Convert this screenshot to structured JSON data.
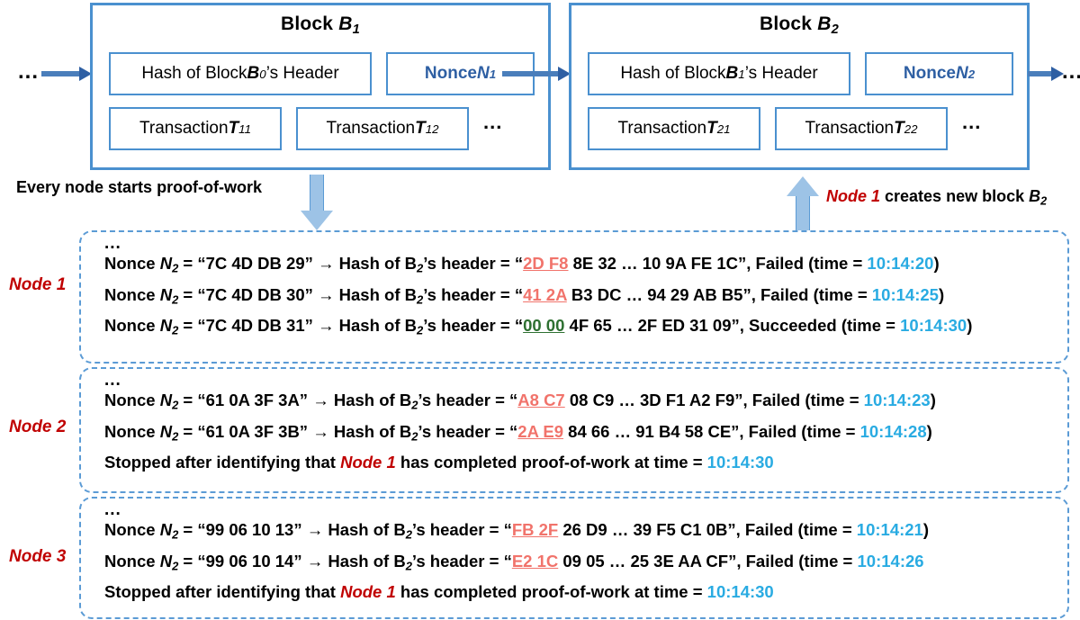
{
  "chain": {
    "left_ellipsis": "...",
    "right_ellipsis": "...",
    "blocks": [
      {
        "title_prefix": "Block ",
        "title_var": "B",
        "title_sub": "1",
        "hash_prefix": "Hash of Block ",
        "hash_var": "B",
        "hash_sub": "0",
        "hash_suffix": "’s Header",
        "nonce_prefix": "Nonce ",
        "nonce_var": "N",
        "nonce_sub": "1",
        "txn_1_prefix": "Transaction ",
        "txn_1_var": "T",
        "txn_1_sub": "11",
        "txn_2_prefix": "Transaction ",
        "txn_2_var": "T",
        "txn_2_sub": "12",
        "txn_ellipsis": "..."
      },
      {
        "title_prefix": "Block ",
        "title_var": "B",
        "title_sub": "2",
        "hash_prefix": "Hash of Block ",
        "hash_var": "B",
        "hash_sub": "1",
        "hash_suffix": "’s Header",
        "nonce_prefix": "Nonce ",
        "nonce_var": "N",
        "nonce_sub": "2",
        "txn_1_prefix": "Transaction ",
        "txn_1_var": "T",
        "txn_1_sub": "21",
        "txn_2_prefix": "Transaction ",
        "txn_2_var": "T",
        "txn_2_sub": "22",
        "txn_ellipsis": "..."
      }
    ]
  },
  "annotations": {
    "start_label": "Every node starts proof-of-work",
    "creates_node": "Node 1",
    "creates_rest_prefix": " creates new block ",
    "creates_block_var": "B",
    "creates_block_sub": "2"
  },
  "nodes": [
    {
      "tag": "Node 1",
      "ellipsis": "...",
      "lines": [
        {
          "kind": "attempt",
          "nonce_label": "Nonce ",
          "nonce_var": "N",
          "nonce_sub": "2",
          "eq": " = ",
          "nonce_value": "“7C 4D DB 29”",
          "arrow": "→",
          "hash_label": " Hash of B",
          "hash_sub": "2",
          "hash_label_tail": "’s header = ",
          "open_quote": "“",
          "hash_head": "2D F8",
          "hash_head_status": "bad",
          "hash_tail": " 8E 32 … 10 9A FE 1C”",
          "result": ", Failed (time = ",
          "time": "10:14:20",
          "close": ")"
        },
        {
          "kind": "attempt",
          "nonce_label": "Nonce ",
          "nonce_var": "N",
          "nonce_sub": "2",
          "eq": " = ",
          "nonce_value": "“7C 4D DB 30”",
          "arrow": "→",
          "hash_label": " Hash of B",
          "hash_sub": "2",
          "hash_label_tail": "’s header = ",
          "open_quote": "“",
          "hash_head": "41 2A",
          "hash_head_status": "bad",
          "hash_tail": " B3 DC … 94 29 AB B5”",
          "result": ", Failed (time = ",
          "time": "10:14:25",
          "close": ")"
        },
        {
          "kind": "attempt",
          "nonce_label": "Nonce ",
          "nonce_var": "N",
          "nonce_sub": "2",
          "eq": " = ",
          "nonce_value": "“7C 4D DB 31”",
          "arrow": "→",
          "hash_label": " Hash of B",
          "hash_sub": "2",
          "hash_label_tail": "’s header = ",
          "open_quote": "“",
          "hash_head": "00 00",
          "hash_head_status": "good",
          "hash_tail": " 4F 65 … 2F ED 31 09”",
          "result": ", Succeeded (time = ",
          "time": "10:14:30",
          "close": ")"
        }
      ]
    },
    {
      "tag": "Node 2",
      "ellipsis": "...",
      "lines": [
        {
          "kind": "attempt",
          "nonce_label": "Nonce ",
          "nonce_var": "N",
          "nonce_sub": "2",
          "eq": " = ",
          "nonce_value": "“61 0A 3F 3A”",
          "arrow": "→",
          "hash_label": " Hash of B",
          "hash_sub": "2",
          "hash_label_tail": "’s header = ",
          "open_quote": "“",
          "hash_head": "A8 C7",
          "hash_head_status": "bad",
          "hash_tail": " 08 C9 … 3D F1 A2 F9”",
          "result": ", Failed (time = ",
          "time": "10:14:23",
          "close": ")"
        },
        {
          "kind": "attempt",
          "nonce_label": "Nonce ",
          "nonce_var": "N",
          "nonce_sub": "2",
          "eq": " = ",
          "nonce_value": "“61 0A 3F 3B”",
          "arrow": "→",
          "hash_label": " Hash of B",
          "hash_sub": "2",
          "hash_label_tail": "’s header = ",
          "open_quote": "“",
          "hash_head": "2A E9",
          "hash_head_status": "bad",
          "hash_tail": " 84 66 … 91 B4 58 CE”",
          "result": ", Failed (time = ",
          "time": "10:14:28",
          "close": ")"
        },
        {
          "kind": "stopped",
          "stopped_prefix": "Stopped after identifying that ",
          "stopped_node": "Node 1",
          "stopped_mid": " has completed proof-of-work at time = ",
          "time": "10:14:30",
          "close": ""
        }
      ]
    },
    {
      "tag": "Node 3",
      "ellipsis": "...",
      "lines": [
        {
          "kind": "attempt",
          "nonce_label": "Nonce ",
          "nonce_var": "N",
          "nonce_sub": "2",
          "eq": " = ",
          "nonce_value": "“99 06 10 13”",
          "arrow": "→",
          "hash_label": " Hash of B",
          "hash_sub": "2",
          "hash_label_tail": "’s header = ",
          "open_quote": "“",
          "hash_head": "FB 2F",
          "hash_head_status": "bad",
          "hash_tail": " 26 D9 … 39 F5 C1 0B”",
          "result": ", Failed (time = ",
          "time": "10:14:21",
          "close": ")"
        },
        {
          "kind": "attempt",
          "nonce_label": "Nonce ",
          "nonce_var": "N",
          "nonce_sub": "2",
          "eq": " = ",
          "nonce_value": "“99 06 10 14”",
          "arrow": "→",
          "hash_label": " Hash of B",
          "hash_sub": "2",
          "hash_label_tail": "’s header = ",
          "open_quote": "“",
          "hash_head": "E2 1C",
          "hash_head_status": "bad",
          "hash_tail": " 09 05 … 25 3E AA CF”",
          "result": ", Failed (time = ",
          "time": "10:14:26",
          "close": ""
        },
        {
          "kind": "stopped",
          "stopped_prefix": "Stopped after identifying that ",
          "stopped_node": "Node 1",
          "stopped_mid": " has completed proof-of-work at time = ",
          "time": "10:14:30",
          "close": ""
        }
      ]
    }
  ],
  "colors": {
    "block_border": "#4A90CF",
    "nonce_text": "#2E5FA3",
    "panel_border": "#5B9BD5",
    "node_tag": "#C00000",
    "time": "#29ABE2",
    "hash_bad": "#F1736B",
    "hash_good": "#2E7031",
    "arrow_fill": "#9DC3E6"
  }
}
